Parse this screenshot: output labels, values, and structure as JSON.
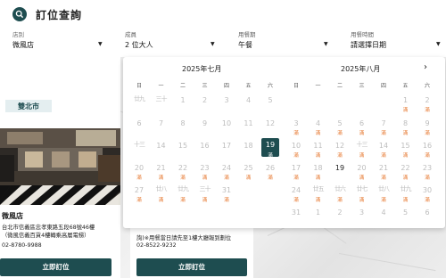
{
  "header": {
    "title": "訂位查詢"
  },
  "filters": [
    {
      "label": "店別",
      "value": "微風店"
    },
    {
      "label": "成員",
      "value": "2 位大人"
    },
    {
      "label": "用餐期",
      "value": "午餐"
    },
    {
      "label": "用餐時間",
      "value": "請選擇日期"
    }
  ],
  "region_tag": "雙北市",
  "restaurant": {
    "name": "微風店",
    "address_line1": "台北市信義區忠孝東路五段68號46樓",
    "address_line2": "（微風信義百貨4樓轉乘高層電梯）",
    "phone": "02-8780-9988",
    "book_label": "立即訂位"
  },
  "restaurant2": {
    "note": "詢)※用餐當日請先至1樓大廳報到劃位",
    "phone": "02-8522-9232",
    "book_label": "立即訂位"
  },
  "calendar": {
    "weekdays": [
      "日",
      "一",
      "二",
      "三",
      "四",
      "五",
      "六"
    ],
    "full_label": "滿",
    "selected_day": "19",
    "months": [
      {
        "title": "2025年七月",
        "rows": [
          [
            {
              "d": "廿九",
              "m": "a"
            },
            {
              "d": "三十",
              "m": "a"
            },
            {
              "d": "1"
            },
            {
              "d": "2"
            },
            {
              "d": "3"
            },
            {
              "d": "4"
            },
            {
              "d": "5"
            }
          ],
          [
            {
              "d": "6"
            },
            {
              "d": "7"
            },
            {
              "d": "8"
            },
            {
              "d": "9"
            },
            {
              "d": "10"
            },
            {
              "d": "11"
            },
            {
              "d": "12"
            }
          ],
          [
            {
              "d": "十三",
              "m": "a"
            },
            {
              "d": "14"
            },
            {
              "d": "15"
            },
            {
              "d": "16"
            },
            {
              "d": "17"
            },
            {
              "d": "18"
            },
            {
              "d": "19",
              "sel": true,
              "full": true
            }
          ],
          [
            {
              "d": "20",
              "full": true
            },
            {
              "d": "21",
              "full": true
            },
            {
              "d": "22",
              "full": true
            },
            {
              "d": "23",
              "full": true
            },
            {
              "d": "24",
              "full": true
            },
            {
              "d": "25",
              "full": true
            },
            {
              "d": "26",
              "full": true
            }
          ],
          [
            {
              "d": "27",
              "full": true
            },
            {
              "d": "廿八",
              "m": "a",
              "full": true
            },
            {
              "d": "廿九",
              "m": "a",
              "full": true
            },
            {
              "d": "三十",
              "m": "a",
              "full": true
            },
            {
              "d": "31",
              "full": true
            },
            {
              "d": ""
            },
            {
              "d": ""
            }
          ]
        ]
      },
      {
        "title": "2025年八月",
        "rows": [
          [
            {
              "d": ""
            },
            {
              "d": ""
            },
            {
              "d": ""
            },
            {
              "d": ""
            },
            {
              "d": ""
            },
            {
              "d": "1",
              "full": true
            },
            {
              "d": "2",
              "full": true
            }
          ],
          [
            {
              "d": "3",
              "full": true
            },
            {
              "d": "4",
              "full": true
            },
            {
              "d": "5",
              "full": true
            },
            {
              "d": "6",
              "full": true
            },
            {
              "d": "7",
              "full": true
            },
            {
              "d": "8",
              "full": true
            },
            {
              "d": "9",
              "full": true
            }
          ],
          [
            {
              "d": "10",
              "full": true
            },
            {
              "d": "11",
              "full": true
            },
            {
              "d": "12",
              "full": true
            },
            {
              "d": "十三",
              "m": "a",
              "full": true
            },
            {
              "d": "14",
              "full": true
            },
            {
              "d": "15",
              "full": true
            },
            {
              "d": "16",
              "full": true
            }
          ],
          [
            {
              "d": "17",
              "full": true
            },
            {
              "d": "18",
              "full": true
            },
            {
              "d": "19",
              "avail": true
            },
            {
              "d": "20",
              "full": true
            },
            {
              "d": "21",
              "full": true
            },
            {
              "d": "22",
              "full": true
            },
            {
              "d": "23",
              "full": true
            }
          ],
          [
            {
              "d": "24",
              "full": true
            },
            {
              "d": "廿五",
              "m": "a",
              "full": true
            },
            {
              "d": "廿六",
              "m": "a",
              "full": true
            },
            {
              "d": "廿七",
              "m": "a",
              "full": true
            },
            {
              "d": "廿八",
              "m": "a",
              "full": true
            },
            {
              "d": "廿九",
              "m": "a",
              "full": true
            },
            {
              "d": "30",
              "full": true
            }
          ],
          [
            {
              "d": "31"
            },
            {
              "d": "1"
            },
            {
              "d": "2"
            },
            {
              "d": "3"
            },
            {
              "d": "4"
            },
            {
              "d": "5"
            },
            {
              "d": "6"
            }
          ]
        ]
      }
    ]
  },
  "colors": {
    "accent": "#1e4d50",
    "full": "#e6762d",
    "disabled": "#bdbdbd"
  }
}
